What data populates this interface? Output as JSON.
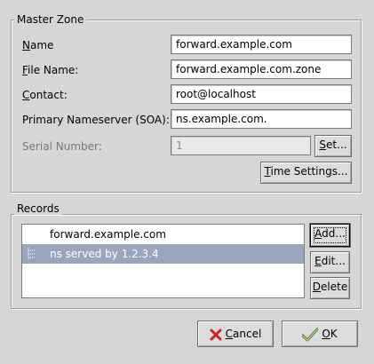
{
  "master_zone": {
    "legend": "Master Zone",
    "name": {
      "label_accel": "N",
      "label_rest": "ame",
      "value": "forward.example.com"
    },
    "file_name": {
      "label_accel": "F",
      "label_rest": "ile Name:",
      "value": "forward.example.com.zone"
    },
    "contact": {
      "label_accel": "C",
      "label_rest": "ontact:",
      "value": "root@localhost"
    },
    "primary_ns": {
      "label": "Primary Nameserver (SOA):",
      "value": "ns.example.com."
    },
    "serial": {
      "label": "Serial Number:",
      "value": "1"
    },
    "set_button": {
      "accel": "S",
      "rest": "et..."
    },
    "time_button": {
      "accel": "T",
      "rest": "ime Settings..."
    }
  },
  "records": {
    "legend": "Records",
    "items": [
      {
        "text": "forward.example.com"
      },
      {
        "text": "ns served by 1.2.3.4"
      }
    ],
    "add_button": {
      "accel": "A",
      "rest": "dd..."
    },
    "edit_button": {
      "accel": "E",
      "rest": "dit..."
    },
    "delete_button": {
      "accel": "D",
      "rest": "elete"
    }
  },
  "footer": {
    "cancel": {
      "accel": "C",
      "rest": "ancel",
      "icon": "cancel-x-icon",
      "icon_color": "#c8242b"
    },
    "ok": {
      "accel": "O",
      "rest": "K",
      "icon": "ok-check-icon",
      "icon_color": "#5a7a3a"
    }
  }
}
